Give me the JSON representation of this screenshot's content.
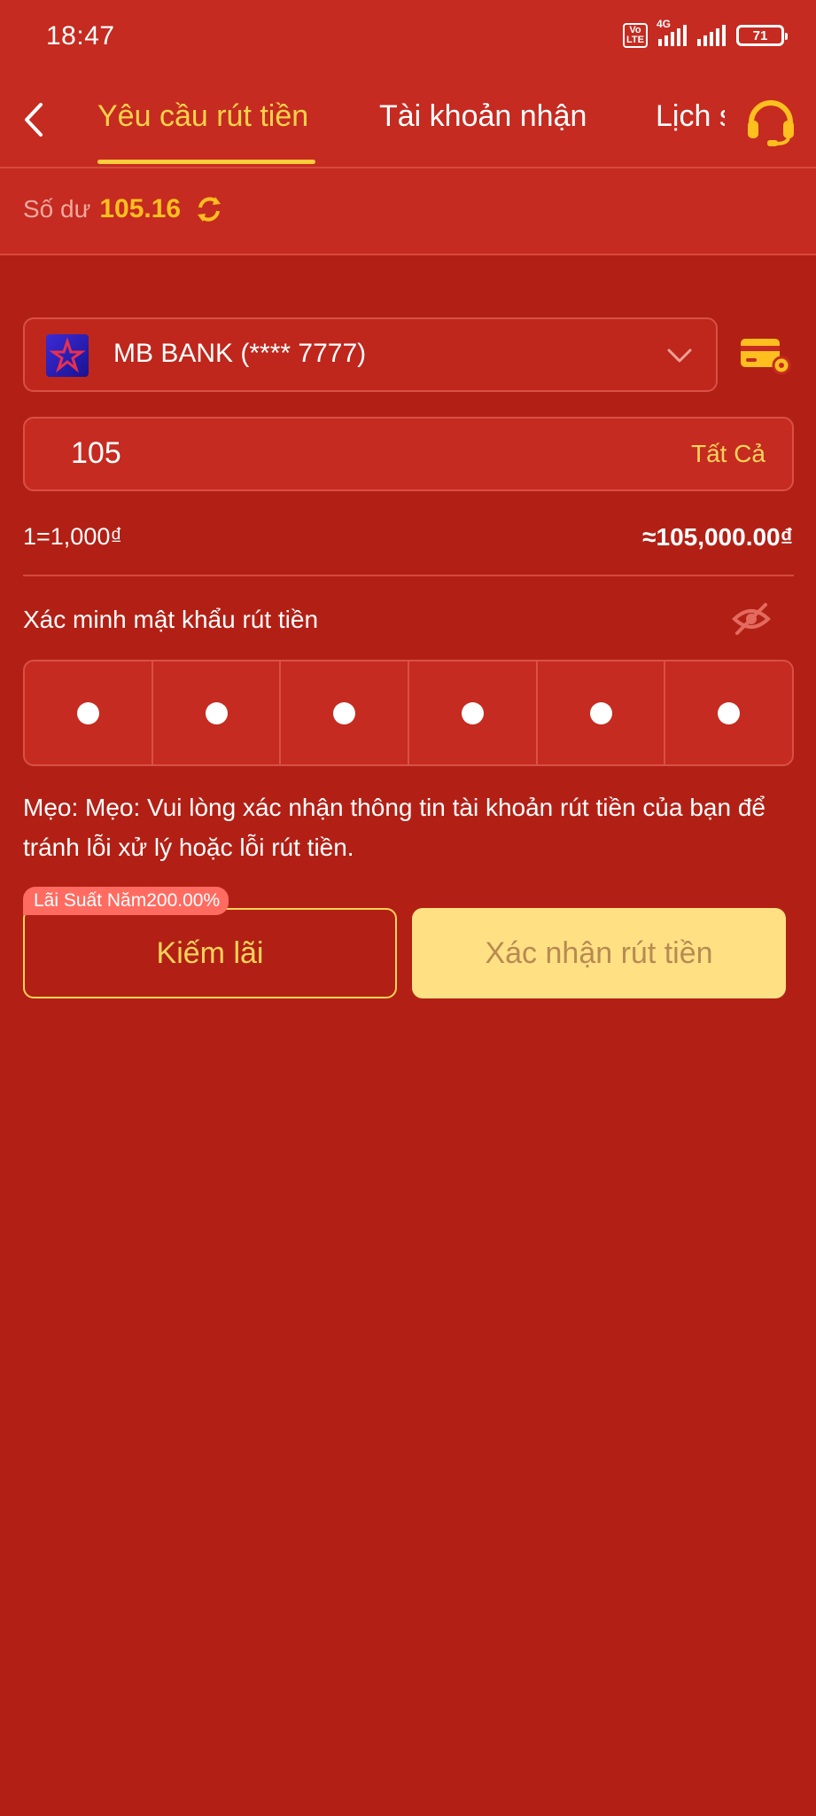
{
  "status_bar": {
    "time": "18:47",
    "volte": "Vo LTE",
    "network": "4G",
    "battery": "71"
  },
  "tabs": [
    {
      "label": "Yêu cầu rút tiền",
      "active": true
    },
    {
      "label": "Tài khoản nhận",
      "active": false
    },
    {
      "label": "Lịch sử",
      "active": false
    }
  ],
  "balance": {
    "label": "Số dư",
    "value": "105.16"
  },
  "bank": {
    "name": "MB BANK (**** 7777)"
  },
  "amount": {
    "value": "105",
    "all_label": "Tất Cả"
  },
  "rate": {
    "text": "1=1,000₫",
    "converted": "≈105,000.00₫"
  },
  "password": {
    "label": "Xác minh mật khẩu rút tiền",
    "dot_count": 6
  },
  "tip": "Mẹo: Mẹo: Vui lòng xác nhận thông tin tài khoản rút tiền của bạn để tránh lỗi xử lý hoặc lỗi rút tiền.",
  "actions": {
    "badge": "Lãi Suất Năm200.00%",
    "earn_label": "Kiếm lãi",
    "confirm_label": "Xác nhận rút tiền"
  },
  "colors": {
    "accent": "#ffcd3a",
    "background": "#b22015",
    "header": "#c52b20",
    "confirm": "#ffe184"
  }
}
